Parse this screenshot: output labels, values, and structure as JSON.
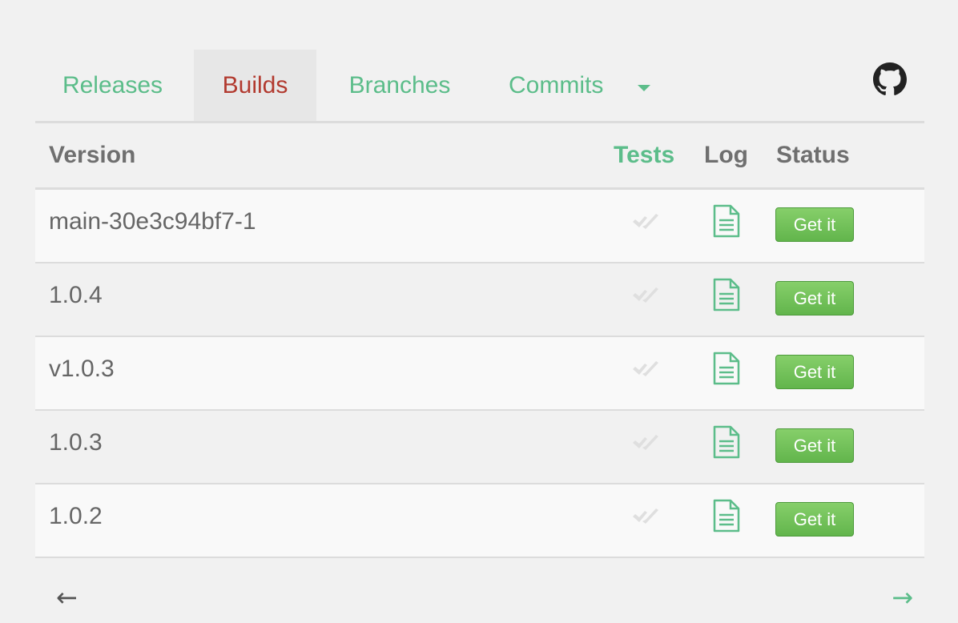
{
  "tabs": {
    "releases": "Releases",
    "builds": "Builds",
    "branches": "Branches",
    "commits": "Commits"
  },
  "table": {
    "headers": {
      "version": "Version",
      "tests": "Tests",
      "log": "Log",
      "status": "Status"
    },
    "rows": [
      {
        "version": "main-30e3c94bf7-1",
        "status_label": "Get it"
      },
      {
        "version": "1.0.4",
        "status_label": "Get it"
      },
      {
        "version": "v1.0.3",
        "status_label": "Get it"
      },
      {
        "version": "1.0.3",
        "status_label": "Get it"
      },
      {
        "version": "1.0.2",
        "status_label": "Get it"
      }
    ]
  },
  "pager": {
    "prev": "←",
    "next": "→"
  },
  "icons": {
    "github": "github-icon",
    "tests_check": "checkmark-icon",
    "log": "document-icon",
    "caret": "caret-down-icon"
  },
  "colors": {
    "accent": "#5cbd8a",
    "active_tab": "#b23a2f",
    "button": "#6bbd55"
  }
}
